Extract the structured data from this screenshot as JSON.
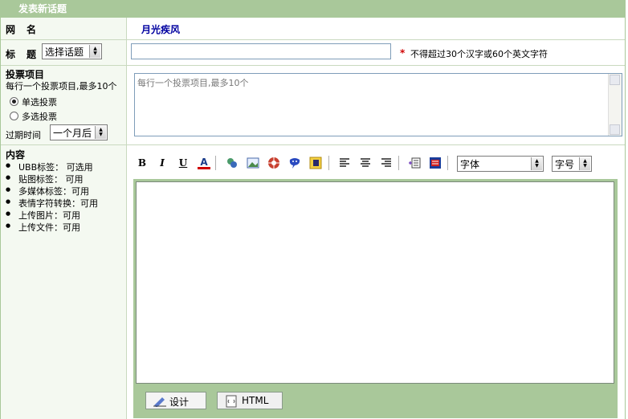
{
  "header": {
    "title": "发表新话题"
  },
  "username": {
    "label": "网　名",
    "value": "月光疾风"
  },
  "subject": {
    "label": "标　题",
    "topic_select": "选择话题",
    "hint": "不得超过30个汉字或60个英文字符",
    "required_mark": "*"
  },
  "poll": {
    "title": "投票项目",
    "desc": "每行一个投票项目,最多10个",
    "placeholder": "每行一个投票项目,最多10个",
    "single": "单选投票",
    "multi": "多选投票",
    "single_checked": true,
    "expire_label": "过期时间",
    "expire_value": "一个月后"
  },
  "content": {
    "title": "内容",
    "items": [
      "UBB标签： 可选用",
      "贴图标签： 可用",
      "多媒体标签：可用",
      "表情字符转换：可用",
      "上传图片：可用",
      "上传文件：可用"
    ]
  },
  "editor": {
    "toolbar_icons": [
      "bold-icon",
      "italic-icon",
      "underline-icon",
      "font-color-icon",
      "link-icon",
      "image-icon",
      "media-icon",
      "emoticon-icon",
      "flash-icon",
      "align-left-icon",
      "align-center-icon",
      "align-right-icon",
      "insert-table-icon",
      "word-paste-icon"
    ],
    "bold": "B",
    "italic": "I",
    "underline": "U",
    "color": "A",
    "font_select": "字体",
    "size_select": "字号",
    "design_tab": "设计",
    "html_tab": "HTML"
  },
  "colors": {
    "header_bg": "#a9c89a",
    "link_blue": "#0000a0",
    "required_red": "#d00000",
    "editor_border": "#a9c89a"
  }
}
